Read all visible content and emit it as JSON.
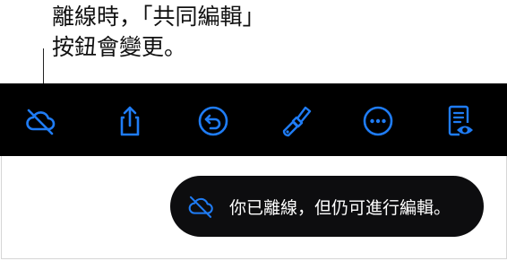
{
  "callout": {
    "line1": "離線時，「共同編輯」",
    "line2": "按鈕會變更。"
  },
  "toolbar": {
    "accent_color": "#1f7cf5",
    "buttons": [
      {
        "name": "offline-collaboration-button",
        "icon": "cloud-slash-icon"
      },
      {
        "name": "share-button",
        "icon": "share-icon"
      },
      {
        "name": "undo-button",
        "icon": "undo-icon"
      },
      {
        "name": "format-button",
        "icon": "paintbrush-icon"
      },
      {
        "name": "more-button",
        "icon": "ellipsis-icon"
      },
      {
        "name": "reading-view-button",
        "icon": "document-eye-icon"
      }
    ]
  },
  "toast": {
    "icon": "cloud-slash-icon",
    "icon_color": "#1f7cf5",
    "message": "你已離線，但仍可進行編輯。"
  }
}
